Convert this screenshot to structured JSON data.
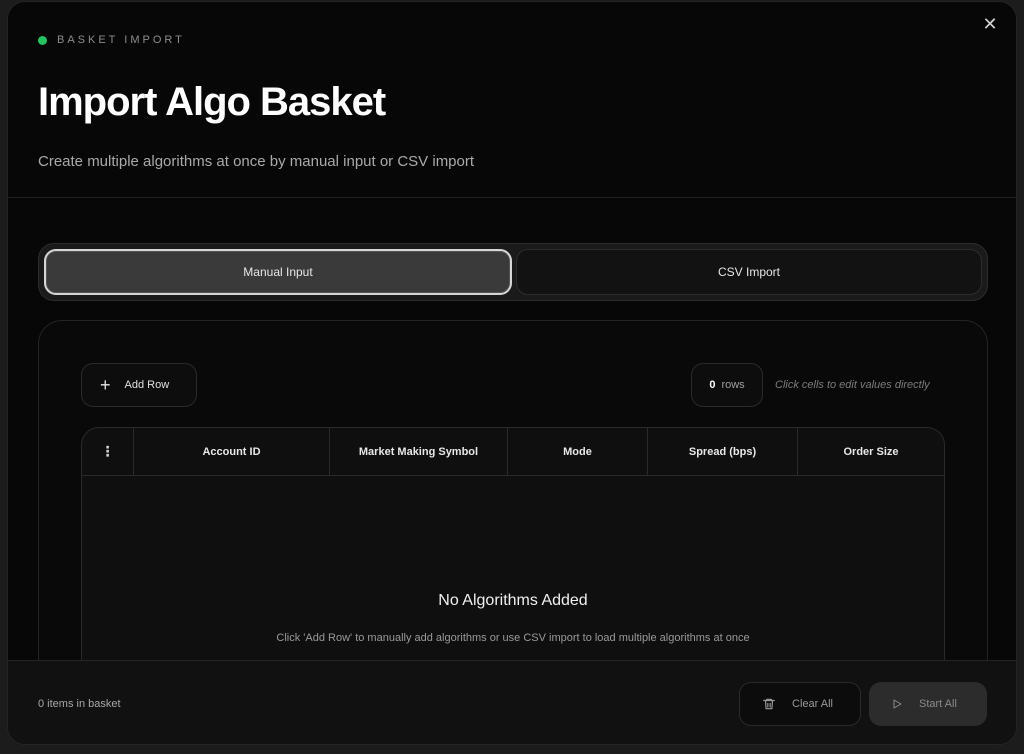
{
  "modal": {
    "kicker": "BASKET IMPORT",
    "title": "Import Algo Basket",
    "subtitle": "Create multiple algorithms at once by manual input or CSV import",
    "close_icon": "close-icon",
    "status_color": "#22c55e"
  },
  "tabs": [
    {
      "label": "Manual Input",
      "active": true
    },
    {
      "label": "CSV Import",
      "active": false
    }
  ],
  "toolbar": {
    "add_row_label": "Add Row",
    "rows_count": "0",
    "rows_label": "rows",
    "hint": "Click cells to edit values directly"
  },
  "table": {
    "columns": [
      "Account ID",
      "Market Making Symbol",
      "Mode",
      "Spread (bps)",
      "Order Size"
    ],
    "rows": []
  },
  "empty_state": {
    "title": "No Algorithms Added",
    "description": "Click 'Add Row' to manually add algorithms or use CSV import to load multiple algorithms at once"
  },
  "footer": {
    "basket_count": "0 items in basket",
    "clear_label": "Clear All",
    "start_label": "Start All"
  }
}
